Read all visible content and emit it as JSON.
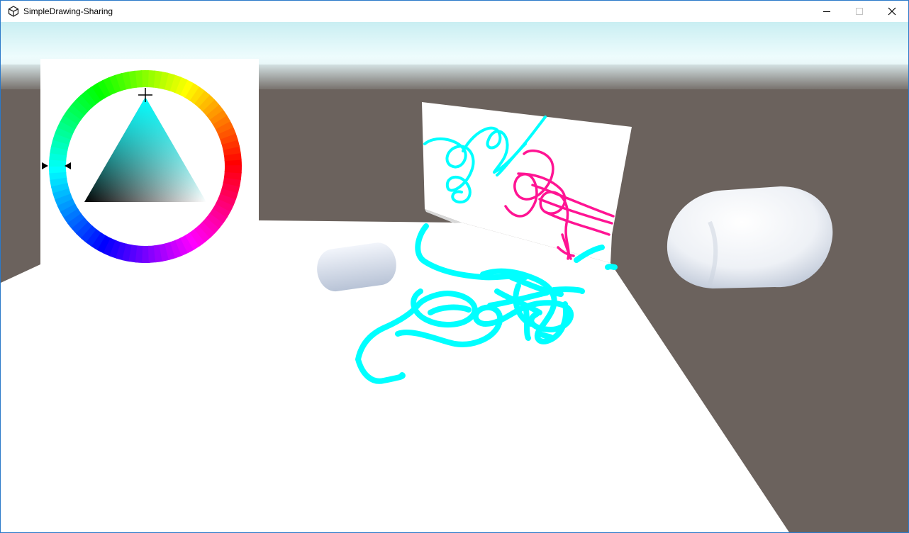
{
  "window": {
    "title": "SimpleDrawing-Sharing",
    "app_icon": "unity-icon",
    "controls": {
      "minimize": "minimize-icon",
      "maximize": "maximize-icon",
      "close": "close-icon"
    }
  },
  "scene": {
    "sky_color": "#e6fafc",
    "ground_color": "#6b625d",
    "stroke_colors": {
      "cyan": "#00ffff",
      "magenta": "#ff1493"
    },
    "color_picker": {
      "selected_hue": "cyan",
      "selected_color": "#00ffff",
      "wheel_icon": "hue-wheel",
      "triangle_icon": "saturation-value-triangle",
      "marker_icon": "crosshair-cursor-icon"
    }
  }
}
